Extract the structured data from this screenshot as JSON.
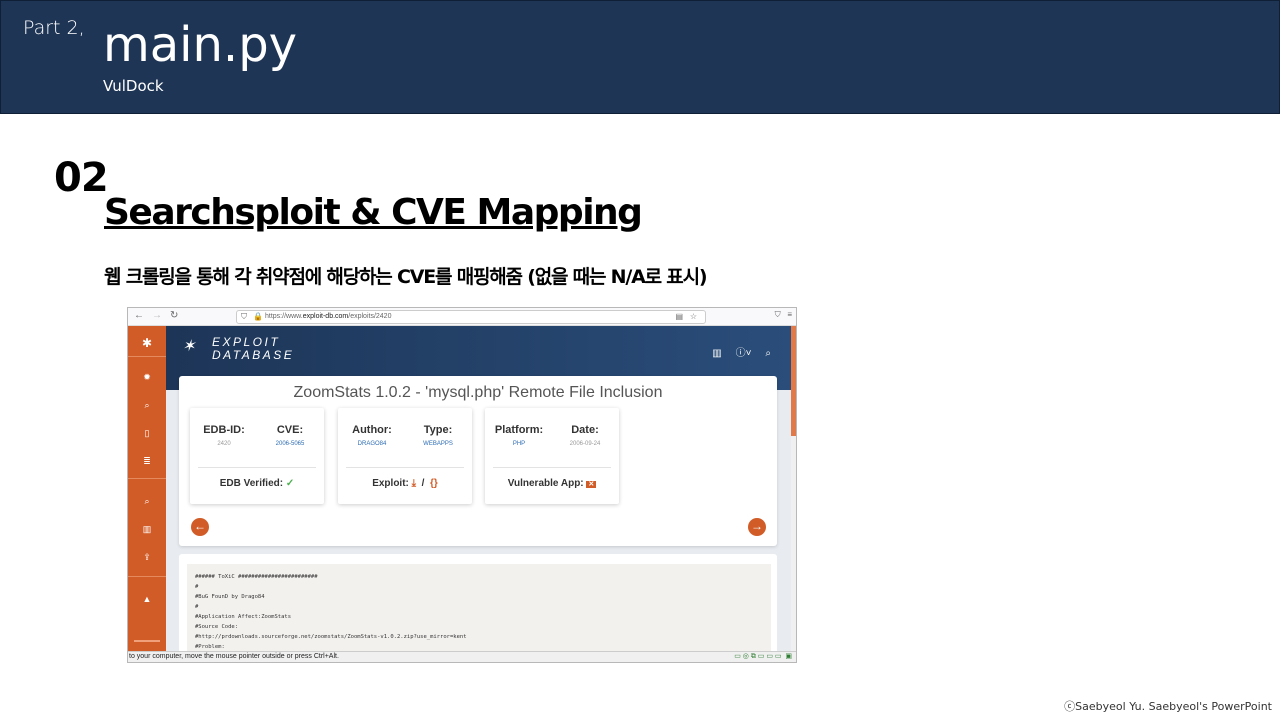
{
  "header": {
    "part": "Part 2,",
    "title": "main.py",
    "subtitle": "VulDock"
  },
  "section": {
    "number": "02",
    "title": "Searchsploit & CVE Mapping",
    "description": "웹 크롤링을 통해 각 취약점에 해당하는 CVE를 매핑해줌  (없을 때는 N/A로 표시)"
  },
  "footer": "ⓒSaebyeol Yu. Saebyeol's PowerPoint",
  "screenshot": {
    "url_prefix": "https://www.",
    "url_domain": "exploit-db.com",
    "url_path": "/exploits/2420",
    "logo_line1": "EXPLOIT",
    "logo_line2": "DATABASE",
    "exploit_title": "ZoomStats 1.0.2 - 'mysql.php' Remote File Inclusion",
    "edb_id_label": "EDB-ID:",
    "edb_id_value": "2420",
    "cve_label": "CVE:",
    "cve_value": "2006-5065",
    "edb_verified_label": "EDB Verified:",
    "author_label": "Author:",
    "author_value": "DRAGO84",
    "type_label": "Type:",
    "type_value": "WEBAPPS",
    "exploit_label": "Exploit:",
    "platform_label": "Platform:",
    "platform_value": "PHP",
    "date_label": "Date:",
    "date_value": "2006-09-24",
    "vulnerable_app_label": "Vulnerable App:",
    "code_lines": [
      "###### ToXiC ########################",
      "#",
      "#BuG FounD  by Drago84",
      "#",
      "#Application Affect:ZoomStats",
      "#Source Code:",
      "#http://prdownloads.sourceforge.net/zoomstats/ZoomStats-v1.0.2.zip?use_mirror=kent",
      "#Problem:"
    ],
    "status_text": "to your computer, move the mouse pointer outside or press Ctrl+Alt."
  },
  "colors": {
    "header_bg": "#1f3556",
    "sidebar": "#d15c27",
    "banner": "#1d3557",
    "link_blue": "#2d6db5"
  }
}
